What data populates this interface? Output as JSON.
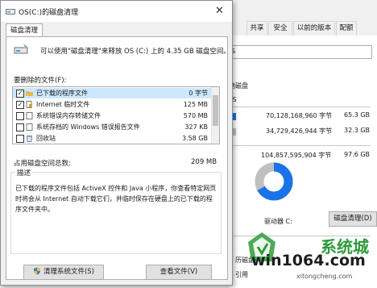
{
  "props": {
    "tabs": [
      "共享",
      "安全",
      "以前的版本",
      "配额"
    ],
    "fs_fragment": "S",
    "disk_label_fragment": "地磁盘",
    "fs_type_fragment": "FS",
    "rows": [
      {
        "bytes": "70,128,168,960 字节",
        "size": "65.3 GB",
        "color": "#1a73e8"
      },
      {
        "bytes": "34,729,426,944 字节",
        "size": "32.3 GB",
        "color": "#c0c0c0"
      },
      {
        "bytes": "104,857,595,904 字节",
        "size": "97.6 GB",
        "color": ""
      }
    ],
    "drive_label": "驱动器 C:",
    "cleanup_button": "磁盘清理(D)",
    "bottom_fragment_1": "历磁盘",
    "bottom_fragment_2": "引用"
  },
  "dialog": {
    "title": "OS(C:)的磁盘清理",
    "tab": "磁盘清理",
    "intro": "可以使用\"磁盘清理\"来释放 OS (C:) 上的 4.35 GB 磁盘空间。",
    "files_label": "要删除的文件(F):",
    "files": [
      {
        "checked": true,
        "name": "已下载的程序文件",
        "size": "0 字节",
        "selected": true,
        "icon": "folder-icon"
      },
      {
        "checked": true,
        "name": "Internet 临时文件",
        "size": "125 MB",
        "selected": false,
        "icon": "lock-file-icon"
      },
      {
        "checked": false,
        "name": "系统错误内存转储文件",
        "size": "570 MB",
        "selected": false,
        "icon": "file-icon"
      },
      {
        "checked": false,
        "name": "系统存档的 Windows 错误报告文件",
        "size": "327 KB",
        "selected": false,
        "icon": "file-icon"
      },
      {
        "checked": false,
        "name": "回收站",
        "size": "3.58 GB",
        "selected": false,
        "icon": "recycle-bin-icon"
      }
    ],
    "total_label": "占用磁盘空间总数:",
    "total_value": "209 MB",
    "description_label": "描述",
    "description": "已下载的程序文件包括 ActiveX 控件和 Java 小程序，你查看特定网页时将会从 Internet 自动下载它们，并临时保存在硬盘上的已下载的程序文件夹中。",
    "cleanup_system_button": "清理系统文件(S)",
    "view_files_button": "查看文件(V)"
  },
  "watermark": {
    "text": "win1064.com",
    "brand": "系统城",
    "url": "xitongcheng.com"
  }
}
